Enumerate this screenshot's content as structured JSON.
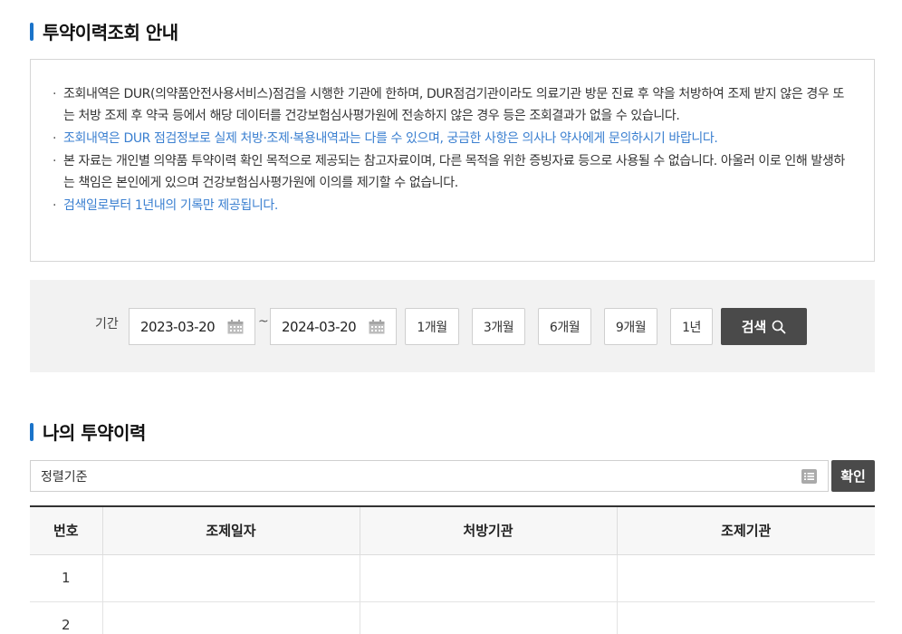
{
  "guide": {
    "title": "투약이력조회 안내",
    "items": [
      {
        "text": "조회내역은 DUR(의약품안전사용서비스)점검을 시행한 기관에 한하며, DUR점검기관이라도 의료기관 방문 진료 후 약을 처방하여 조제 받지 않은 경우 또는 처방 조제 후 약국 등에서 해당 데이터를 건강보험심사평가원에 전송하지 않은 경우 등은 조회결과가 없을 수 있습니다.",
        "highlight": false
      },
      {
        "text": "조회내역은 DUR 점검정보로 실제 처방·조제·복용내역과는 다를 수 있으며, 궁금한 사항은 의사나 약사에게 문의하시기 바랍니다.",
        "highlight": true
      },
      {
        "text": "본 자료는 개인별 의약품 투약이력 확인 목적으로 제공되는 참고자료이며, 다른 목적을 위한 증빙자료 등으로 사용될 수 없습니다. 아울러 이로 인해 발생하는 책임은 본인에게 있으며 건강보험심사평가원에 이의를 제기할 수 없습니다.",
        "highlight": false
      },
      {
        "text": "검색일로부터 1년내의 기록만 제공됩니다.",
        "highlight": true
      }
    ],
    "highlight_color": "#3a7fd0"
  },
  "search": {
    "period_label": "기간",
    "start_date": "2023-03-20",
    "end_date": "2024-03-20",
    "separator": "~",
    "period_buttons": [
      "1개월",
      "3개월",
      "6개월",
      "9개월",
      "1년"
    ],
    "search_label": "검색",
    "search_icon": "search-icon",
    "calendar_icon": "calendar-icon"
  },
  "history": {
    "title": "나의 투약이력",
    "sort_value": "정렬기준",
    "sort_icon": "list-icon",
    "confirm_label": "확인",
    "columns": [
      "번호",
      "조제일자",
      "처방기관",
      "조제기관"
    ],
    "rows": [
      [
        "1",
        "",
        "",
        ""
      ],
      [
        "2",
        "",
        "",
        ""
      ]
    ]
  },
  "colors": {
    "accent": "#1a73c9",
    "dark_button": "#4a4a4a",
    "panel_bg": "#f2f2f2"
  }
}
